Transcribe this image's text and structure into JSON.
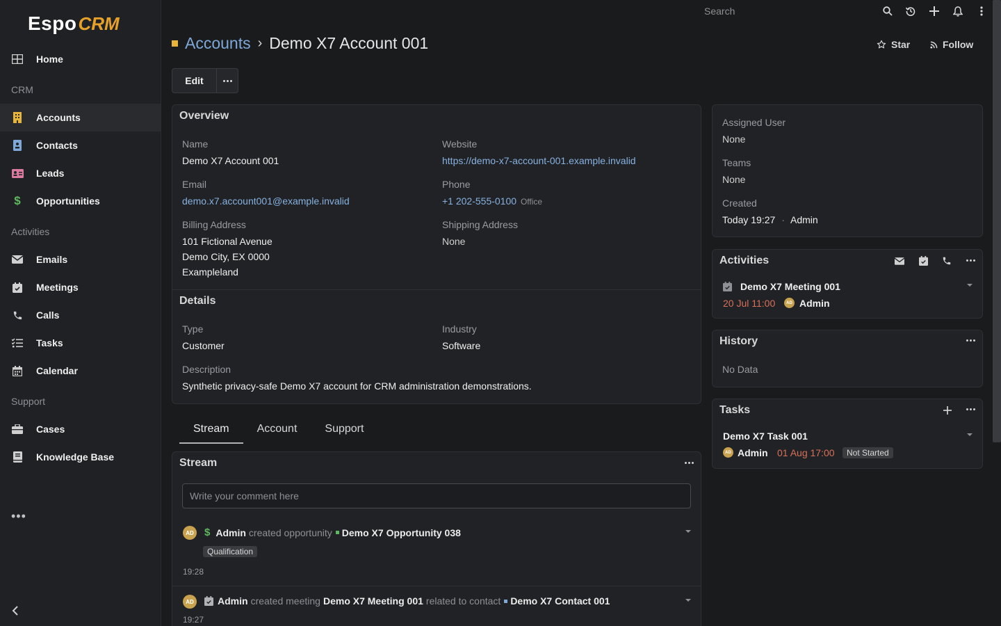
{
  "app": {
    "logo_main": "Espo",
    "logo_accent": "CRM"
  },
  "sidebar": {
    "home": "Home",
    "section_crm": "CRM",
    "accounts": "Accounts",
    "contacts": "Contacts",
    "leads": "Leads",
    "opportunities": "Opportunities",
    "section_activities": "Activities",
    "emails": "Emails",
    "meetings": "Meetings",
    "calls": "Calls",
    "tasks": "Tasks",
    "calendar": "Calendar",
    "section_support": "Support",
    "cases": "Cases",
    "knowledge_base": "Knowledge Base",
    "more": "•••"
  },
  "topbar": {
    "search_placeholder": "Search"
  },
  "header": {
    "breadcrumb_parent": "Accounts",
    "breadcrumb_sep": "›",
    "record_name": "Demo X7 Account 001",
    "star_label": "Star",
    "follow_label": "Follow",
    "edit_label": "Edit"
  },
  "overview": {
    "title": "Overview",
    "name_label": "Name",
    "name_value": "Demo X7 Account 001",
    "website_label": "Website",
    "website_value": "https://demo-x7-account-001.example.invalid",
    "email_label": "Email",
    "email_value": "demo.x7.account001@example.invalid",
    "phone_label": "Phone",
    "phone_value": "+1 202-555-0100",
    "phone_type": "Office",
    "billing_label": "Billing Address",
    "billing_line1": "101 Fictional Avenue",
    "billing_line2": "Demo City, EX 0000",
    "billing_line3": "Exampleland",
    "shipping_label": "Shipping Address",
    "shipping_value": "None"
  },
  "details": {
    "title": "Details",
    "type_label": "Type",
    "type_value": "Customer",
    "industry_label": "Industry",
    "industry_value": "Software",
    "description_label": "Description",
    "description_value": "Synthetic privacy-safe Demo X7 account for CRM administration demonstrations."
  },
  "tabs": [
    "Stream",
    "Account",
    "Support"
  ],
  "stream": {
    "title": "Stream",
    "comment_placeholder": "Write your comment here",
    "entries": [
      {
        "avatar": "AD",
        "user": "Admin",
        "action": "created opportunity",
        "target": "Demo X7 Opportunity 038",
        "badge": "Qualification",
        "time": "19:28"
      },
      {
        "avatar": "AD",
        "user": "Admin",
        "action": "created meeting",
        "target": "Demo X7 Meeting 001",
        "relation": "related to contact",
        "related": "Demo X7 Contact 001",
        "time": "19:27"
      }
    ]
  },
  "side_info": {
    "assigned_label": "Assigned User",
    "assigned_value": "None",
    "teams_label": "Teams",
    "teams_value": "None",
    "created_label": "Created",
    "created_value": "Today 19:27",
    "created_sep": "·",
    "created_by": "Admin"
  },
  "activities": {
    "title": "Activities",
    "item_name": "Demo X7 Meeting 001",
    "item_date": "20 Jul 11:00",
    "item_avatar": "AD",
    "item_user": "Admin"
  },
  "history": {
    "title": "History",
    "empty": "No Data"
  },
  "tasks_panel": {
    "title": "Tasks",
    "item_name": "Demo X7 Task 001",
    "item_avatar": "AD",
    "item_user": "Admin",
    "item_date": "01 Aug 17:00",
    "item_status": "Not Started"
  },
  "colors": {
    "accent": "#e8b53b",
    "link": "#86b1e0",
    "overdue": "#d9705a",
    "background": "#1a1b1d"
  }
}
